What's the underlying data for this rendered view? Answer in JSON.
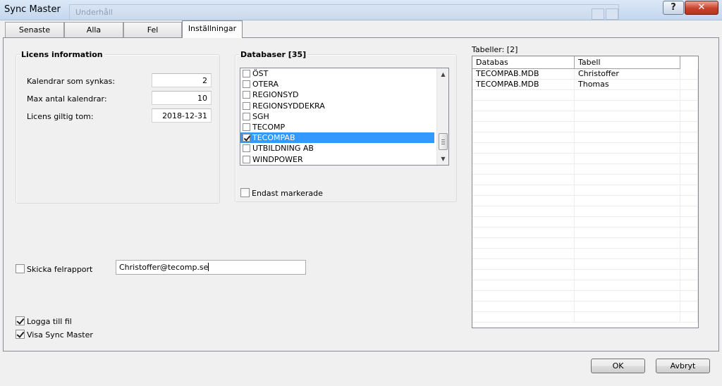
{
  "window": {
    "title": "Sync Master",
    "background_tab": "Underhåll"
  },
  "tabs": [
    {
      "label": "Senaste"
    },
    {
      "label": "Alla"
    },
    {
      "label": "Fel"
    },
    {
      "label": "Inställningar",
      "active": true
    }
  ],
  "license": {
    "heading": "Licens information",
    "fields": [
      {
        "label": "Kalendrar som synkas:",
        "value": "2"
      },
      {
        "label": "Max antal kalendrar:",
        "value": "10"
      },
      {
        "label": "Licens giltig tom:",
        "value": "2018-12-31"
      }
    ]
  },
  "databases": {
    "heading": "Databaser [35]",
    "items": [
      {
        "label": "ÖST",
        "checked": false
      },
      {
        "label": "OTERA",
        "checked": false
      },
      {
        "label": "REGIONSYD",
        "checked": false
      },
      {
        "label": "REGIONSYDDEKRA",
        "checked": false
      },
      {
        "label": "SGH",
        "checked": false
      },
      {
        "label": "TECOMP",
        "checked": false
      },
      {
        "label": "TECOMPAB",
        "checked": true,
        "selected": true
      },
      {
        "label": "UTBILDNING AB",
        "checked": false
      },
      {
        "label": "WINDPOWER",
        "checked": false
      }
    ],
    "only_marked_label": "Endast markerade",
    "only_marked_checked": false
  },
  "error_report": {
    "label": "Skicka felrapport",
    "checked": false,
    "email": "Christoffer@tecomp.se"
  },
  "options": [
    {
      "label": "Logga till fil",
      "checked": true
    },
    {
      "label": "Visa Sync Master",
      "checked": true
    }
  ],
  "tables": {
    "heading": "Tabeller: [2]",
    "columns": [
      "Databas",
      "Tabell"
    ],
    "rows": [
      [
        "TECOMPAB.MDB",
        "Christoffer"
      ],
      [
        "TECOMPAB.MDB",
        "Thomas"
      ]
    ]
  },
  "buttons": {
    "ok": "OK",
    "cancel": "Avbryt",
    "help": "?"
  },
  "colors": {
    "selection": "#3399ff",
    "close_button": "#c8412b"
  }
}
